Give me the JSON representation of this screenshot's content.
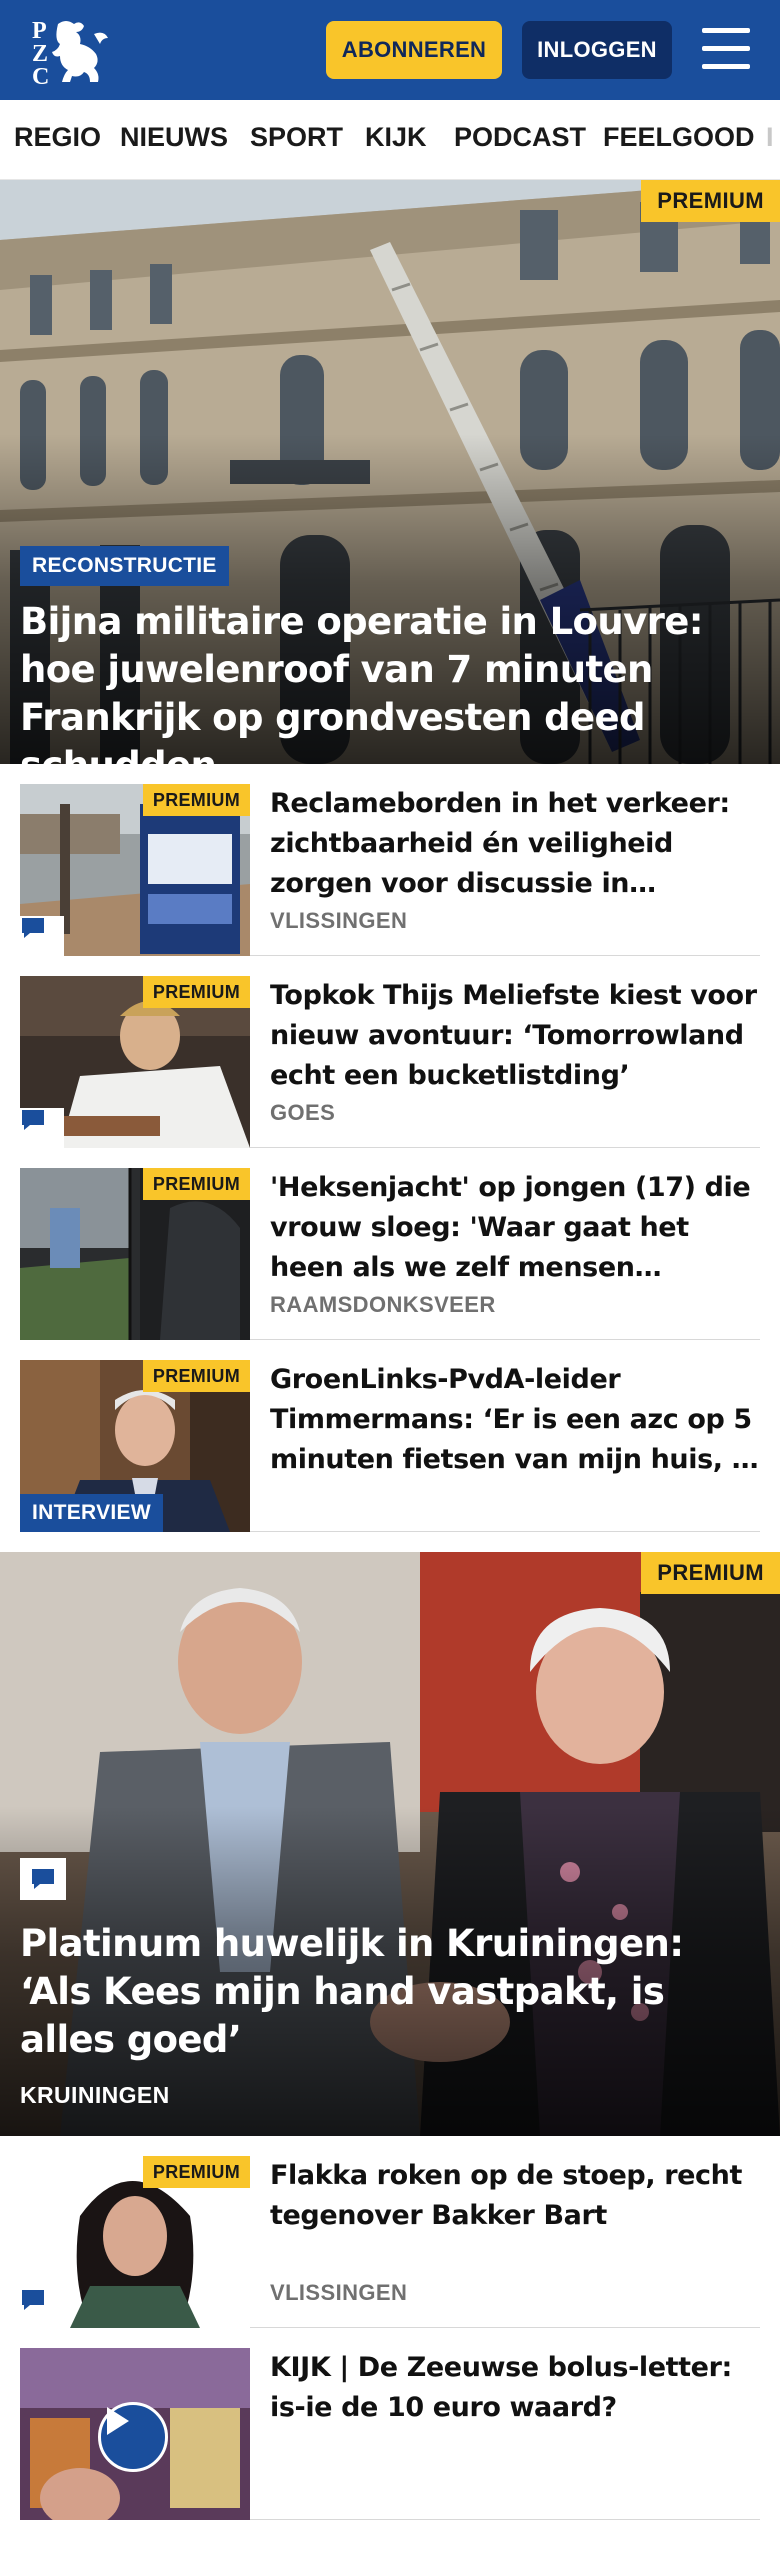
{
  "header": {
    "logo_text": "PZC",
    "subscribe_label": "ABONNEREN",
    "login_label": "INLOGGEN",
    "menu_icon": "hamburger-menu-icon",
    "brand_color": "#1a4e9c",
    "accent_color": "#f9c52a"
  },
  "nav": {
    "items": [
      "REGIO",
      "NIEUWS",
      "SPORT",
      "KIJK",
      "PODCAST",
      "FEELGOOD",
      "I"
    ]
  },
  "premium_label": "PREMIUM",
  "articles": [
    {
      "type": "hero",
      "tag": "RECONSTRUCTIE",
      "title": "Bijna militaire operatie in Louvre: hoe juwelenroof van 7 minuten Frankrijk op grondvesten deed schudden",
      "premium": true
    },
    {
      "type": "row",
      "title": "Reclameborden in het verkeer: zichtbaarheid én veiligheid zorgen voor discussie in Vlissingen",
      "location": "VLISSINGEN",
      "premium": true,
      "comments": true
    },
    {
      "type": "row",
      "title": "Topkok Thijs Meliefste kiest voor nieuw avontuur: ‘Tomorrowland echt een bucketlistding’",
      "location": "GOES",
      "premium": true,
      "comments": true
    },
    {
      "type": "row",
      "title": "'Heksenjacht' op jongen (17) die vrouw sloeg: 'Waar gaat het heen als we zelf mensen opjagen?'",
      "location": "RAAMSDONKSVEER",
      "premium": true,
      "comments": false
    },
    {
      "type": "row",
      "title": "GroenLinks-PvdA-leider Timmermans: ‘Er is een azc op 5 minuten fietsen van mijn huis, ik snap de zorgen’",
      "tag": "INTERVIEW",
      "premium": true,
      "comments": false
    },
    {
      "type": "hero",
      "title": "Platinum huwelijk in Kruiningen: ‘Als Kees mijn hand vastpakt, is alles goed’",
      "location": "KRUININGEN",
      "premium": true,
      "comments": true
    },
    {
      "type": "row",
      "title": "Flakka roken op de stoep, recht tegenover Bakker Bart",
      "location": "VLISSINGEN",
      "premium": true,
      "comments": true
    },
    {
      "type": "row",
      "title": "KIJK | De Zeeuwse bolus-letter: is-ie de 10 euro waard?",
      "video": true,
      "premium": false
    }
  ]
}
